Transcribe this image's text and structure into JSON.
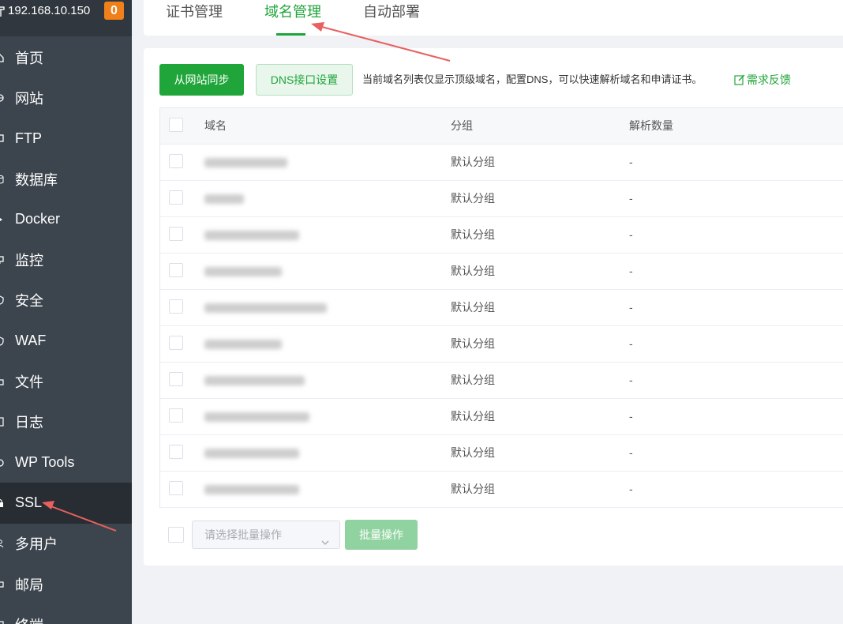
{
  "sidebar": {
    "server_ip": "192.168.10.150",
    "badge_count": "0",
    "items": [
      {
        "label": "首页",
        "icon": "home-icon"
      },
      {
        "label": "网站",
        "icon": "globe-icon"
      },
      {
        "label": "FTP",
        "icon": "ftp-icon"
      },
      {
        "label": "数据库",
        "icon": "database-icon"
      },
      {
        "label": "Docker",
        "icon": "docker-icon"
      },
      {
        "label": "监控",
        "icon": "monitor-icon"
      },
      {
        "label": "安全",
        "icon": "shield-icon"
      },
      {
        "label": "WAF",
        "icon": "waf-icon"
      },
      {
        "label": "文件",
        "icon": "folder-icon"
      },
      {
        "label": "日志",
        "icon": "log-icon"
      },
      {
        "label": "WP Tools",
        "icon": "wordpress-icon"
      },
      {
        "label": "SSL",
        "icon": "ssl-icon",
        "active": true
      },
      {
        "label": "多用户",
        "icon": "users-icon"
      },
      {
        "label": "邮局",
        "icon": "mail-icon"
      },
      {
        "label": "终端",
        "icon": "terminal-icon"
      }
    ]
  },
  "tabs": [
    {
      "label": "证书管理"
    },
    {
      "label": "域名管理",
      "active": true
    },
    {
      "label": "自动部署"
    }
  ],
  "toolbar": {
    "sync_label": "从网站同步",
    "dns_label": "DNS接口设置",
    "hint": "当前域名列表仅显示顶级域名，配置DNS，可以快速解析域名和申请证书。",
    "feedback_label": "需求反馈"
  },
  "table": {
    "headers": {
      "domain": "域名",
      "group": "分组",
      "count": "解析数量"
    },
    "rows": [
      {
        "domain": "",
        "group": "默认分组",
        "count": "-"
      },
      {
        "domain": "",
        "group": "默认分组",
        "count": "-"
      },
      {
        "domain": "",
        "group": "默认分组",
        "count": "-"
      },
      {
        "domain": "",
        "group": "默认分组",
        "count": "-"
      },
      {
        "domain": "",
        "group": "默认分组",
        "count": "-"
      },
      {
        "domain": "",
        "group": "默认分组",
        "count": "-"
      },
      {
        "domain": "",
        "group": "默认分组",
        "count": "-"
      },
      {
        "domain": "",
        "group": "默认分组",
        "count": "-"
      },
      {
        "domain": "",
        "group": "默认分组",
        "count": "-"
      },
      {
        "domain": "",
        "group": "默认分组",
        "count": "-"
      }
    ]
  },
  "footer": {
    "batch_placeholder": "请选择批量操作",
    "batch_button": "批量操作"
  },
  "colors": {
    "accent": "#20a53a",
    "sidebar_bg": "#3c444d",
    "sidebar_active": "#282d33",
    "badge": "#f0801a",
    "annotation_arrow": "#e8605f"
  }
}
